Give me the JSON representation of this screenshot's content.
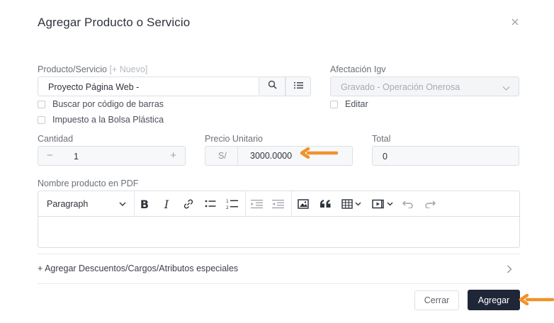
{
  "modal": {
    "title": "Agregar Producto o Servicio"
  },
  "product": {
    "label": "Producto/Servicio",
    "new_link": "[+ Nuevo]",
    "value": "Proyecto Página Web -",
    "barcode_label": "Buscar por código de barras",
    "bag_tax_label": "Impuesto a la Bolsa Plástica"
  },
  "igv": {
    "label": "Afectación Igv",
    "selected": "Gravado - Operación Onerosa",
    "edit_label": "Editar"
  },
  "quantity": {
    "label": "Cantidad",
    "value": "1",
    "minus": "−",
    "plus": "+"
  },
  "price": {
    "label": "Precio Unitario",
    "prefix": "S/",
    "value": "3000.0000"
  },
  "total": {
    "label": "Total",
    "value": "0"
  },
  "pdf_name": {
    "label": "Nombre producto en PDF",
    "block_format": "Paragraph",
    "bold": "B",
    "italic": "I"
  },
  "extras": {
    "label": "+ Agregar Descuentos/Cargos/Atributos especiales"
  },
  "footer": {
    "close_label": "Cerrar",
    "add_label": "Agregar"
  },
  "colors": {
    "primary_button": "#1f2637",
    "annotation_arrow": "#f0922b"
  }
}
